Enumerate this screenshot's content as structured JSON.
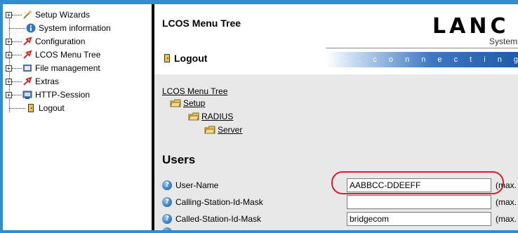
{
  "tree": {
    "items": [
      {
        "label": "Setup Wizards",
        "icon": "wand-icon",
        "expandable": true
      },
      {
        "label": "System information",
        "icon": "info-icon",
        "expandable": false
      },
      {
        "label": "Configuration",
        "icon": "config-arrow-icon",
        "expandable": true
      },
      {
        "label": "LCOS Menu Tree",
        "icon": "menu-tree-arrow-icon",
        "expandable": true
      },
      {
        "label": "File management",
        "icon": "file-icon",
        "expandable": true
      },
      {
        "label": "Extras",
        "icon": "extras-arrow-icon",
        "expandable": true
      },
      {
        "label": "HTTP-Session",
        "icon": "session-icon",
        "expandable": true
      },
      {
        "label": "Logout",
        "icon": "logout-icon",
        "expandable": false
      }
    ]
  },
  "header": {
    "title": "LCOS Menu Tree",
    "logout_label": "Logout",
    "brand_logo": "LANC",
    "brand_sub": "Systems",
    "slogan": ". . .  c o n n e c t i n g   y o u r"
  },
  "breadcrumb": {
    "root": "LCOS Menu Tree",
    "level1": "Setup",
    "level2": "RADIUS",
    "level3": "Server"
  },
  "section": {
    "title": "Users"
  },
  "form": {
    "rows": [
      {
        "label": "User-Name",
        "value": "AABBCC-DDEEFF",
        "suffix": "(max."
      },
      {
        "label": "Calling-Station-Id-Mask",
        "value": "",
        "suffix": "(max."
      },
      {
        "label": "Called-Station-Id-Mask",
        "value": "bridgecom",
        "suffix": "(max."
      }
    ]
  },
  "colors": {
    "frame": "#2d8fd2",
    "highlight": "#d4202a"
  }
}
